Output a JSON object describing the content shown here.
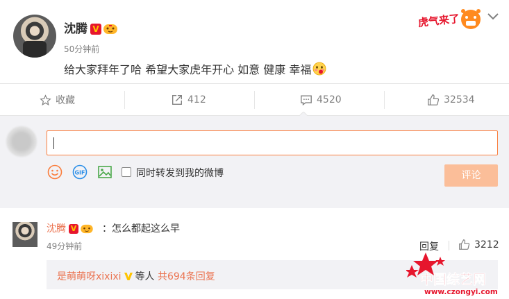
{
  "post": {
    "username": "沈腾",
    "time": "50分钟前",
    "text": "给大家拜年了哈 希望大家虎年开心 如意 健康 幸福",
    "v_badge": "V",
    "deco_text": "虎气来了",
    "icons": [
      "avatar",
      "verified-badge-icon",
      "tiger-badge-icon",
      "blush-emoji-icon",
      "tiger-deco-icon",
      "chevron-down-icon"
    ]
  },
  "actions": {
    "favorite": "收藏",
    "repost": "412",
    "comments": "4520",
    "likes": "32534"
  },
  "compose": {
    "placeholder": "",
    "also_repost": "同时转发到我的微博",
    "submit": "评论",
    "accent": "#fa7d3c"
  },
  "comment": {
    "username": "沈腾",
    "text": "：怎么都起这么早",
    "time": "49分钟前",
    "reply": "回复",
    "likes": "3212",
    "replies_user": "是萌萌呀xixixi",
    "replies_mid": "等人",
    "replies_count": "共694条回复"
  },
  "watermark": {
    "title": "中国综艺网",
    "url": "www.czongyi.com"
  }
}
